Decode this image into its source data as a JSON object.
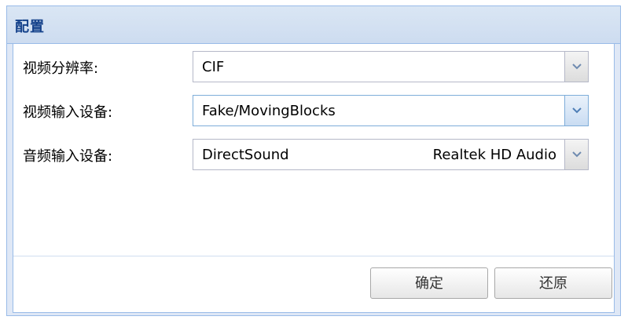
{
  "panel": {
    "title": "配置"
  },
  "form": {
    "rows": [
      {
        "label": "视频分辨率:",
        "value": "CIF",
        "subvalue": ""
      },
      {
        "label": "视频输入设备:",
        "value": "Fake/MovingBlocks",
        "subvalue": ""
      },
      {
        "label": "音频输入设备:",
        "value": "DirectSound",
        "subvalue": "Realtek HD Audio"
      }
    ]
  },
  "buttons": {
    "ok_label": "确定",
    "reset_label": "还原"
  },
  "colors": {
    "header_text": "#15428b",
    "panel_border": "#99bbe8",
    "panel_background": "#dfe8f6"
  },
  "icons": {
    "combo_trigger": "chevron-down-icon"
  }
}
